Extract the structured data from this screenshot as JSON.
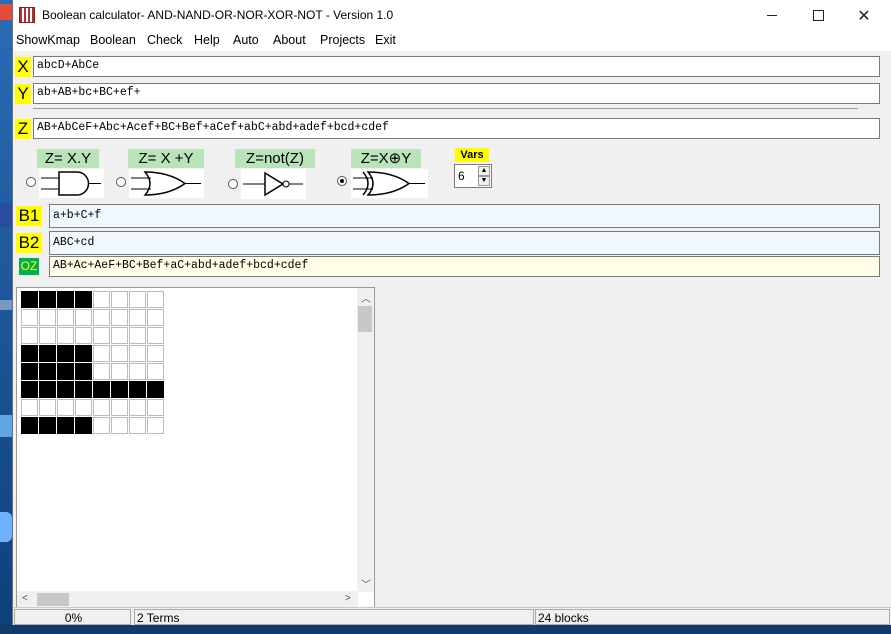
{
  "window": {
    "title": "Boolean calculator- AND-NAND-OR-NOR-XOR-NOT - Version 1.0"
  },
  "menu": [
    "ShowKmap",
    "Boolean",
    "Check",
    "Help",
    "Auto",
    "About",
    "Projects",
    "Exit"
  ],
  "inputs": {
    "x_label": "X",
    "x_value": "abcD+AbCe",
    "y_label": "Y",
    "y_value": "ab+AB+bc+BC+ef+",
    "z_label": "Z",
    "z_value": "AB+AbCeF+Abc+Acef+BC+Bef+aCef+abC+abd+adef+bcd+cdef"
  },
  "operations": [
    {
      "label": "Z= X.Y",
      "gate": "and-gate",
      "selected": false
    },
    {
      "label": "Z= X +Y",
      "gate": "or-gate",
      "selected": false
    },
    {
      "label": "Z=not(Z)",
      "gate": "not-gate",
      "selected": false
    },
    {
      "label": "Z=X⊕Y",
      "gate": "xor-gate",
      "selected": true
    }
  ],
  "vars": {
    "label": "Vars",
    "value": "6"
  },
  "boxes": {
    "b1_label": "B1",
    "b1_value": "a+b+C+f",
    "b2_label": "B2",
    "b2_value": "ABC+cd",
    "oz_label": "OZ",
    "oz_value": "AB+Ac+AeF+BC+Bef+aC+abd+adef+bcd+cdef"
  },
  "kmap": {
    "rows": [
      [
        1,
        1,
        1,
        1,
        0,
        0,
        0,
        0
      ],
      [
        0,
        0,
        0,
        0,
        0,
        0,
        0,
        0
      ],
      [
        0,
        0,
        0,
        0,
        0,
        0,
        0,
        0
      ],
      [
        1,
        1,
        1,
        1,
        0,
        0,
        0,
        0
      ],
      [
        1,
        1,
        1,
        1,
        0,
        0,
        0,
        0
      ],
      [
        1,
        1,
        1,
        1,
        1,
        1,
        1,
        1
      ],
      [
        0,
        0,
        0,
        0,
        0,
        0,
        0,
        0
      ],
      [
        1,
        1,
        1,
        1,
        0,
        0,
        0,
        0
      ]
    ]
  },
  "status": {
    "progress": "0%",
    "terms": "2 Terms",
    "blocks": "24 blocks"
  }
}
